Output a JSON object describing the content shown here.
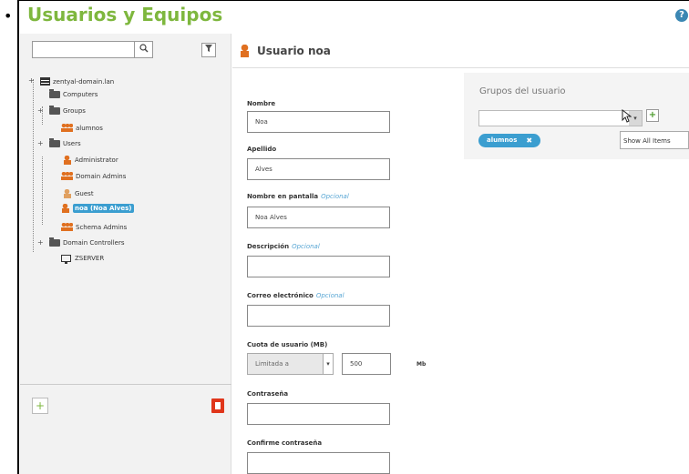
{
  "page": {
    "title": "Usuarios y Equipos",
    "bullet": "•",
    "help_icon": "?"
  },
  "search": {
    "value": "",
    "icon": "search-icon",
    "icon_glyph": "🔍",
    "filter_glyph": "Y"
  },
  "tree": {
    "domain": "zentyal-domain.lan",
    "items": [
      {
        "label": "Computers",
        "type": "folder"
      },
      {
        "label": "Groups",
        "type": "folder"
      },
      {
        "label": "alumnos",
        "type": "group"
      },
      {
        "label": "Users",
        "type": "folder"
      },
      {
        "label": "Administrator",
        "type": "user"
      },
      {
        "label": "Domain Admins",
        "type": "group"
      },
      {
        "label": "Guest",
        "type": "user"
      },
      {
        "label": "noa (Noa Alves)",
        "type": "user",
        "selected": true
      },
      {
        "label": "Schema Admins",
        "type": "group"
      },
      {
        "label": "Domain Controllers",
        "type": "folder"
      },
      {
        "label": "ZSERVER",
        "type": "computer"
      }
    ],
    "expander": "+",
    "add_glyph": "+"
  },
  "header": {
    "title": "Usuario noa"
  },
  "form": {
    "nombre_label": "Nombre",
    "nombre_value": "Noa",
    "apellido_label": "Apellido",
    "apellido_value": "Alves",
    "pantalla_label": "Nombre en pantalla",
    "pantalla_opt": "Opcional",
    "pantalla_value": "Noa Alves",
    "descripcion_label": "Descripción",
    "descripcion_opt": "Opcional",
    "descripcion_value": "",
    "correo_label": "Correo electrónico",
    "correo_opt": "Opcional",
    "correo_value": "",
    "cuota_label": "Cuota de usuario (MB)",
    "cuota_select": "Limitada a",
    "cuota_arrow": "▾",
    "cuota_value": "500",
    "cuota_unit": "Mb",
    "contrasena_label": "Contraseña",
    "contrasena_value": "",
    "confirme_label": "Confirme contraseña",
    "confirme_value": ""
  },
  "groups": {
    "title": "Grupos del usuario",
    "combo_value": "",
    "combo_arrow": "▾",
    "add_glyph": "+",
    "tooltip": "Show All Items",
    "tags": [
      {
        "label": "alumnos",
        "remove": "✖"
      }
    ]
  },
  "colors": {
    "accent_green": "#7eb73e",
    "selection_blue": "#3b9ed0",
    "user_orange": "#e07020",
    "delete_red": "#e0361b"
  }
}
